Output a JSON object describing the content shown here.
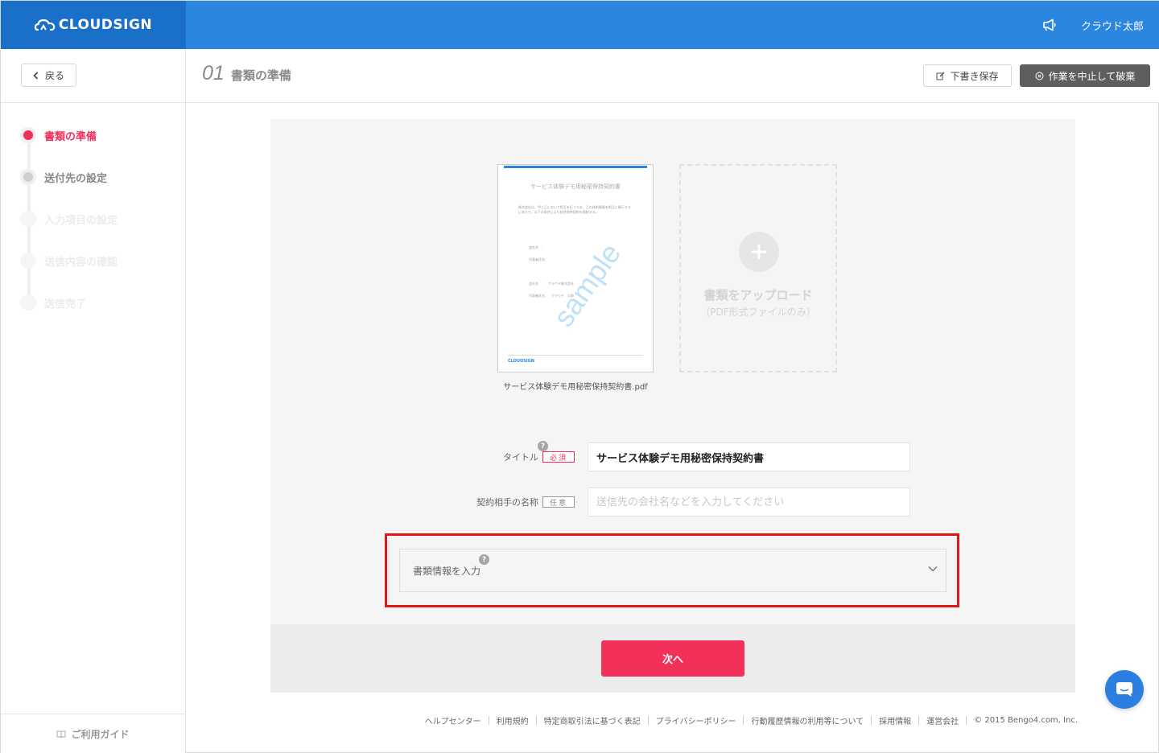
{
  "header": {
    "logo_text": "CLOUDSIGN",
    "user_name": "クラウド太郎"
  },
  "subheader": {
    "back_label": "戻る",
    "step_number": "01",
    "step_title": "書類の準備",
    "draft_label": "下書き保存",
    "abort_label": "作業を中止して破棄"
  },
  "sidebar": {
    "steps": [
      {
        "label": "書類の準備",
        "state": "active"
      },
      {
        "label": "送付先の設定",
        "state": "next"
      },
      {
        "label": "入力項目の設定",
        "state": "disabled"
      },
      {
        "label": "送信内容の確認",
        "state": "disabled"
      },
      {
        "label": "送信完了",
        "state": "disabled"
      }
    ],
    "guide_label": "ご利用ガイド"
  },
  "document": {
    "thumb_title": "サービス体験デモ用秘密保持契約書",
    "thumb_body": "株式会社は、甲と乙において相互を行うため、乙の技術情報を相互に開示するにあたり、以下の条件により秘密保持契約を締結する。",
    "thumb_lines": [
      "会社名　：",
      "代表者氏名：",
      "会社名　：　クラウド株式会社",
      "代表者氏名：　クラウド　太郎"
    ],
    "thumb_watermark": "sample",
    "thumb_footer": "CLOUDSIGN",
    "filename": "サービス体験デモ用秘密保持契約書.pdf"
  },
  "upload": {
    "main_text": "書類をアップロード",
    "sub_text": "（PDF形式ファイルのみ）"
  },
  "form": {
    "title_label": "タイトル",
    "required_badge": "必須",
    "title_value": "サービス体験デモ用秘密保持契約書",
    "partner_label": "契約相手の名称",
    "optional_badge": "任意",
    "partner_value": "",
    "partner_placeholder": "送信先の会社名などを入力してください",
    "doc_info_label": "書類情報を入力",
    "help_glyph": "?"
  },
  "next_label": "次へ",
  "footer": {
    "links": [
      "ヘルプセンター",
      "利用規約",
      "特定商取引法に基づく表記",
      "プライバシーポリシー",
      "行動履歴情報の利用等について",
      "採用情報",
      "運営会社"
    ],
    "copyright": "© 2015 Bengo4.com, Inc."
  },
  "colors": {
    "brand_blue": "#2b86e0",
    "accent_pink": "#f0305a",
    "highlight_red": "#e01717"
  }
}
